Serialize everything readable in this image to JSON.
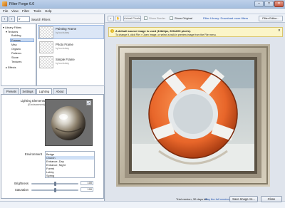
{
  "window": {
    "title": "Filter Forge 6.0",
    "minimize": "–",
    "maximize": "□",
    "close": "✕"
  },
  "menu": [
    "File",
    "View",
    "Filter",
    "Tools",
    "Help"
  ],
  "search": {
    "label": "Search Filters"
  },
  "tree": {
    "root": "Library Filters",
    "textures": "Textures",
    "items": [
      "Building",
      "Frames",
      "Misc",
      "Organic",
      "Patterns",
      "Stone",
      "Textures"
    ],
    "effects": "Effects"
  },
  "filters": [
    {
      "name": "Painting Frame",
      "author": "by kochubey"
    },
    {
      "name": "Photo Frame",
      "author": "by kochubey"
    },
    {
      "name": "Simple Frame",
      "author": "by kochubey"
    }
  ],
  "tabs": [
    "Presets",
    "Settings",
    "Lighting",
    "About"
  ],
  "lighting": {
    "title": "Lighting Elements",
    "subtitle": "(Environment)",
    "env_label": "Environment",
    "env_options": [
      "Bedge",
      "Church",
      "Entrance, Day",
      "Entrance, Night",
      "Forest",
      "Lobby",
      "Spring"
    ],
    "env_selected": 1,
    "brightness_label": "Brightness",
    "brightness_value": "100",
    "brightness_level": 0.5,
    "saturation_label": "Saturation",
    "saturation_value": "100",
    "saturation_level": 0.5
  },
  "help": "Help: Lighting",
  "toolbar": {
    "actual_pixels": "Actual Pixels",
    "show_border": "Show Border",
    "show_original": "Show Original",
    "library_link": "Filter Library: Download more filters",
    "filter_editor": "Filter Editor..."
  },
  "info": {
    "line1": "A default source image is used (16bit/px, 600x600 pixels).",
    "line2": "To change it, click File > Open Image, or select a built-in preview image from the File menu."
  },
  "status": {
    "trial": "Trial version, 30 days left.",
    "buy": "Buy the full version!",
    "save": "Save Image As...",
    "close": "Close"
  },
  "colors": {
    "accent": "#1a4fb0",
    "ring": "#e8662a"
  }
}
